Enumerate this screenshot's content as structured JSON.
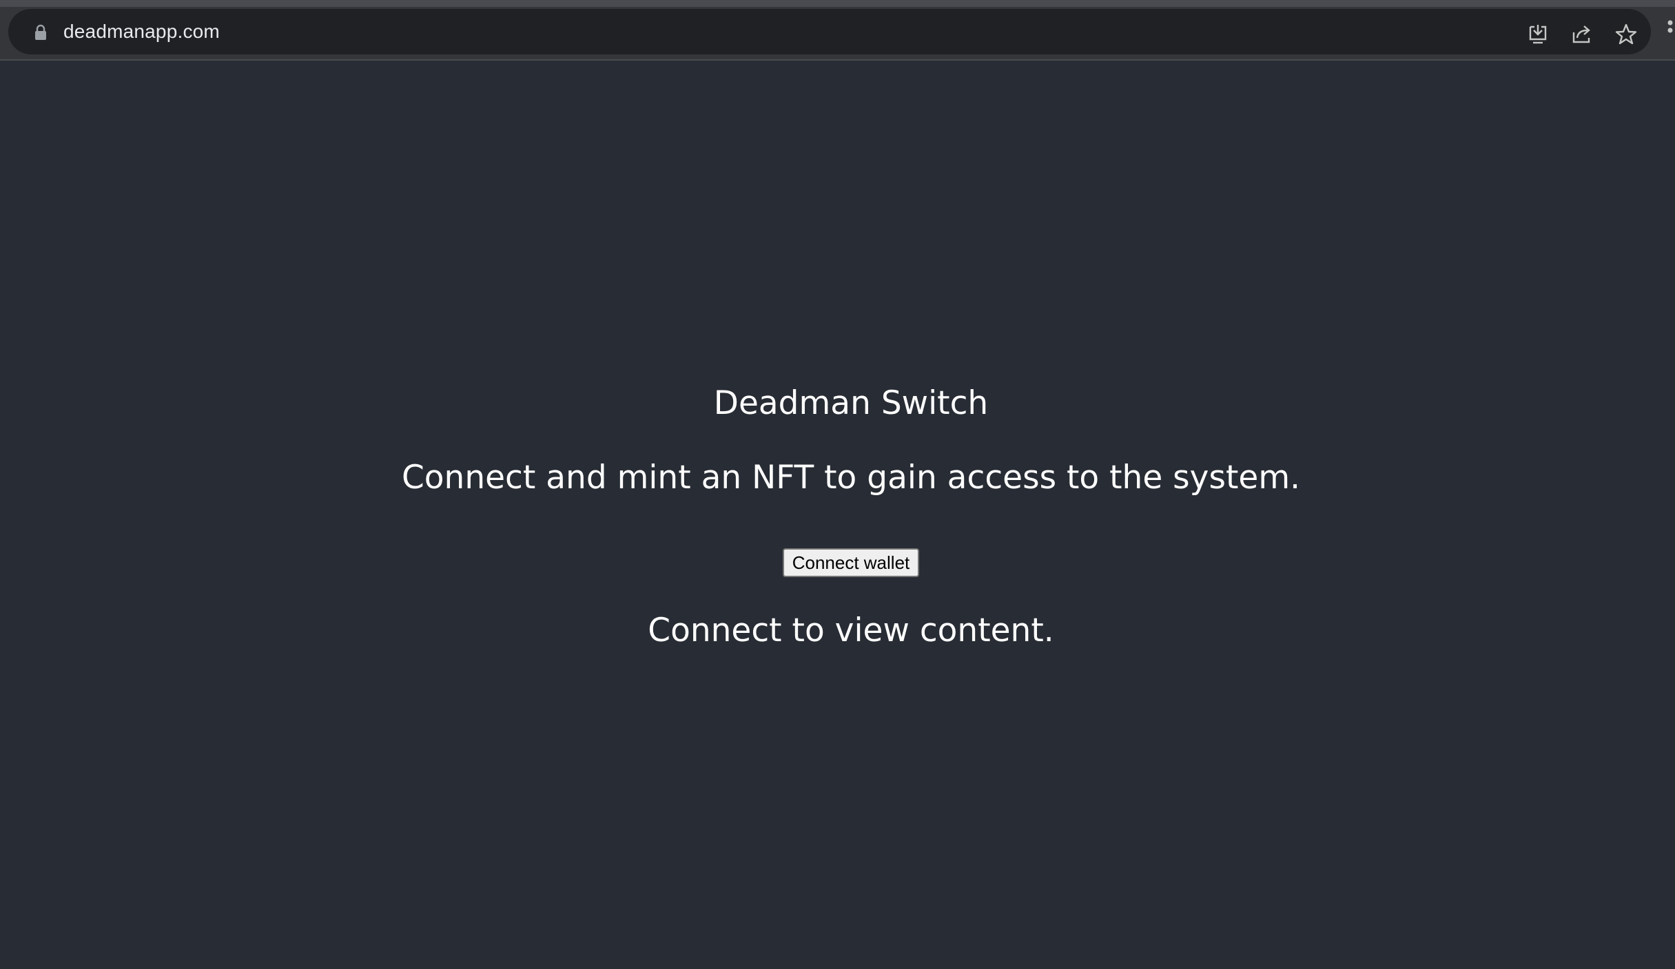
{
  "browser": {
    "url": "deadmanapp.com",
    "icons": [
      "lock-icon",
      "install-icon",
      "share-icon",
      "bookmark-star-icon",
      "menu-icon"
    ]
  },
  "page": {
    "title": "Deadman Switch",
    "subtitle": "Connect and mint an NFT to gain access to the system.",
    "connect_button_label": "Connect wallet",
    "status_text": "Connect to view content."
  },
  "colors": {
    "page_background": "#282c34",
    "text": "#ffffff",
    "browser_bar": "#35363a",
    "omnibox": "#202124"
  }
}
